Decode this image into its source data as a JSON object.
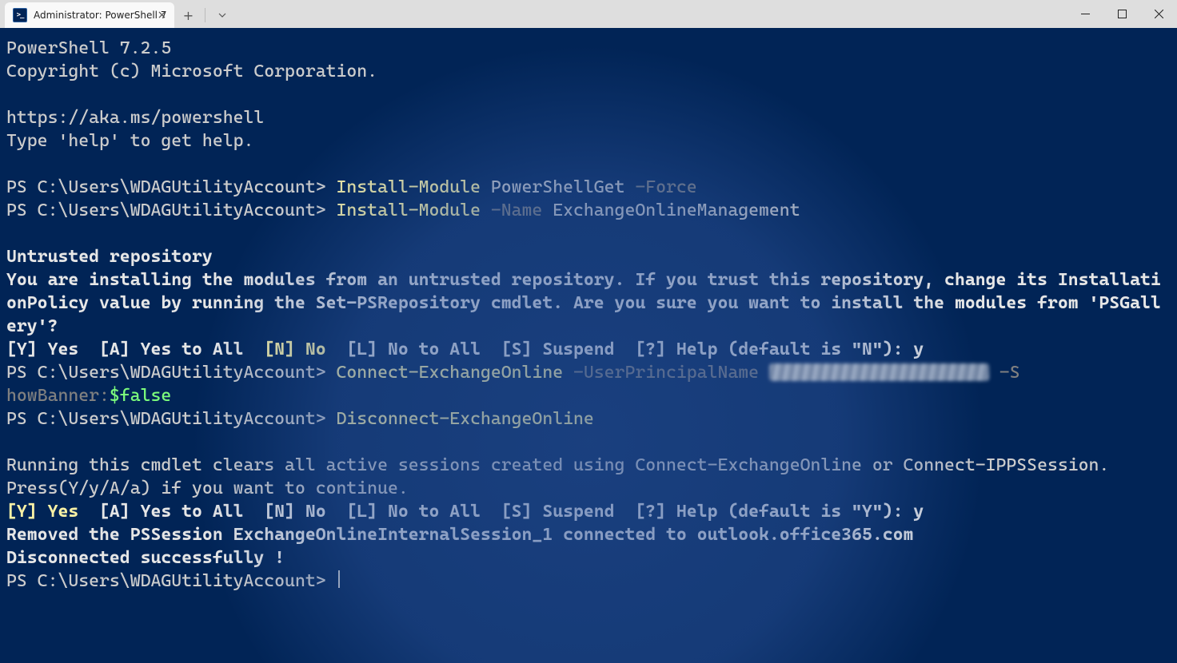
{
  "titlebar": {
    "tab_title": "Administrator: PowerShell 7"
  },
  "banner": {
    "version": "PowerShell 7.2.5",
    "copyright": "Copyright (c) Microsoft Corporation.",
    "link": "https://aka.ms/powershell",
    "help": "Type 'help' to get help."
  },
  "prompt": "PS C:\\Users\\WDAGUtilityAccount> ",
  "lines": {
    "l1_cmd": "Install-Module",
    "l1_arg": " PowerShellGet ",
    "l1_param": "-Force",
    "l2_cmd": "Install-Module",
    "l2_param": " -Name",
    "l2_arg": " ExchangeOnlineManagement",
    "untrusted_h": "Untrusted repository",
    "untrusted_body": "You are installing the modules from an untrusted repository. If you trust this repository, change its InstallationPolicy value by running the Set-PSRepository cmdlet. Are you sure you want to install the modules from 'PSGallery'?",
    "choice_a": "[Y] Yes  [A] Yes to All  ",
    "choice_n": "[N] No",
    "choice_b": "  [L] No to All  [S] Suspend  [?] Help (default is \"N\"): y",
    "l3_cmd": "Connect-ExchangeOnline",
    "l3_param1": " -UserPrincipalName ",
    "l3_param2": " -S",
    "l3_tail1": "howBanner:",
    "l3_var": "$false",
    "l4_cmd": "Disconnect-ExchangeOnline",
    "disc_body1": "Running this cmdlet clears all active sessions created using Connect-ExchangeOnline or Connect-IPPSSession.",
    "disc_body2": "Press(Y/y/A/a) if you want to continue.",
    "choice2_y": "[Y] Yes",
    "choice2_rest": "  [A] Yes to All  [N] No  [L] No to All  [S] Suspend  [?] Help (default is \"Y\"): y",
    "removed": "Removed the PSSession ExchangeOnlineInternalSession_1 connected to outlook.office365.com",
    "disconnected": "Disconnected successfully !"
  }
}
